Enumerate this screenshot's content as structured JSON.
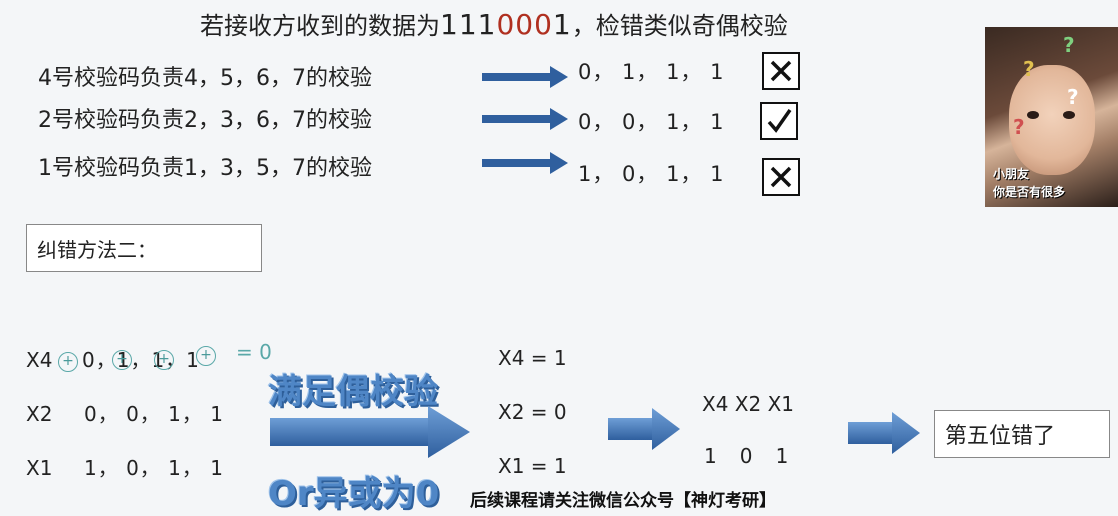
{
  "title": {
    "prefix": "若接收方收到的数据为",
    "digits_a": "111",
    "digits_err": "000",
    "digits_b": "1",
    "suffix": "，检错类似奇偶校验"
  },
  "checks": [
    {
      "label": "4号校验码负责4，5，6，7的校验",
      "values": "0， 1， 1， 1",
      "mark": "cross"
    },
    {
      "label": "2号校验码负责2，3，6，7的校验",
      "values": "0， 0， 1， 1",
      "mark": "tick"
    },
    {
      "label": "1号校验码负责1，3，5，7的校验",
      "values": "1， 0， 1， 1",
      "mark": "cross"
    }
  ],
  "method_box": "纠错方法二：",
  "rows": [
    {
      "label": "X4",
      "values": "0，1，1，1",
      "annotation": "= 0"
    },
    {
      "label": "X2",
      "values": "0， 0， 1， 1"
    },
    {
      "label": "X1",
      "values": "1， 0， 1， 1"
    }
  ],
  "arrow_top_text": "满足偶校验",
  "arrow_bottom_text": "Or异或为0",
  "results": [
    "X4 = 1",
    "X2 = 0",
    "X1 = 1"
  ],
  "combo": {
    "header": "X4 X2 X1",
    "bits": "1   0   1"
  },
  "conclusion": "第五位错了",
  "footer": "后续课程请关注微信公众号【神灯考研】",
  "photo": {
    "caption1": "小朋友",
    "caption2": "你是否有很多"
  },
  "colors": {
    "arrow": "#3f73b5",
    "accent_blue": "#4f86c6",
    "error_digits": "#b03020"
  }
}
